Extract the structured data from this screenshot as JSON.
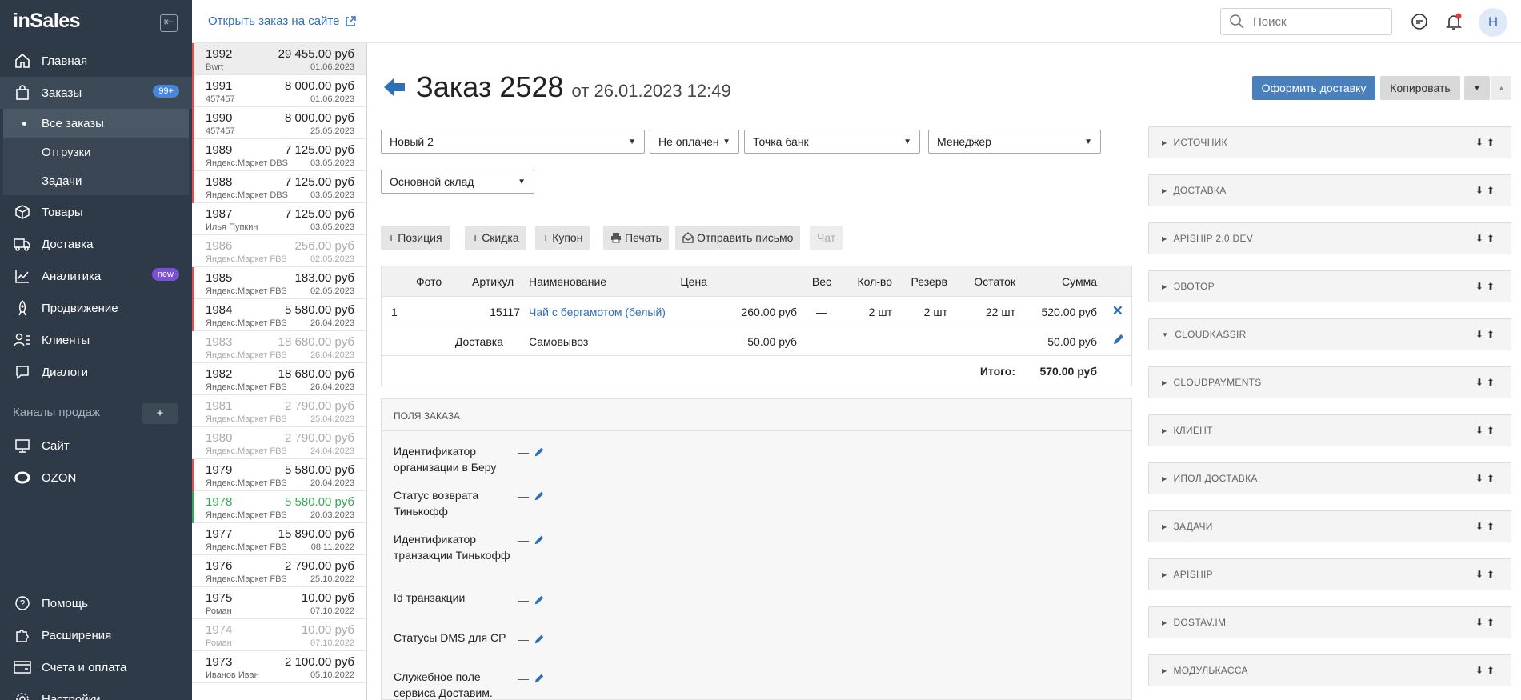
{
  "brand": {
    "logo": "inSales",
    "accent": "#4a7fbe"
  },
  "sidebar": {
    "nav": [
      {
        "label": "Главная",
        "icon": "home-icon"
      },
      {
        "label": "Заказы",
        "icon": "shopping-bag-icon",
        "badge": "99+"
      },
      {
        "label": "Товары",
        "icon": "box-icon"
      },
      {
        "label": "Доставка",
        "icon": "truck-icon"
      },
      {
        "label": "Аналитика",
        "icon": "chart-line-icon",
        "badge": "new"
      },
      {
        "label": "Продвижение",
        "icon": "rocket-icon"
      },
      {
        "label": "Клиенты",
        "icon": "users-icon"
      },
      {
        "label": "Диалоги",
        "icon": "chat-icon"
      }
    ],
    "orders_sub": [
      "Все заказы",
      "Отгрузки",
      "Задачи"
    ],
    "channels_label": "Каналы продаж",
    "channels_plus": "+",
    "channels": [
      {
        "label": "Сайт",
        "icon": "monitor-icon"
      },
      {
        "label": "OZON",
        "icon": "ozon-icon"
      }
    ],
    "bottom": [
      {
        "label": "Помощь",
        "icon": "help-icon"
      },
      {
        "label": "Расширения",
        "icon": "puzzle-icon"
      },
      {
        "label": "Счета и оплата",
        "icon": "wallet-icon"
      },
      {
        "label": "Настройки",
        "icon": "gear-icon"
      }
    ]
  },
  "topbar": {
    "open_link": "Открыть заказ на сайте",
    "search_placeholder": "Поиск",
    "avatar": "Н"
  },
  "orders": [
    {
      "num": "1992",
      "amount": "29 455.00 руб",
      "customer": "Bwrt",
      "date": "01.06.2023",
      "mark": "red",
      "selected": true
    },
    {
      "num": "1991",
      "amount": "8 000.00 руб",
      "customer": "457457",
      "date": "01.06.2023",
      "mark": "red"
    },
    {
      "num": "1990",
      "amount": "8 000.00 руб",
      "customer": "457457",
      "date": "25.05.2023",
      "mark": "red"
    },
    {
      "num": "1989",
      "amount": "7 125.00 руб",
      "customer": "Яндекс.Маркет DBS",
      "date": "03.05.2023",
      "mark": "red"
    },
    {
      "num": "1988",
      "amount": "7 125.00 руб",
      "customer": "Яндекс.Маркет DBS",
      "date": "03.05.2023",
      "mark": "red"
    },
    {
      "num": "1987",
      "amount": "7 125.00 руб",
      "customer": "Илья Пупкин",
      "date": "03.05.2023",
      "mark": ""
    },
    {
      "num": "1986",
      "amount": "256.00 руб",
      "customer": "Яндекс.Маркет FBS",
      "date": "02.05.2023",
      "mark": "",
      "muted": true
    },
    {
      "num": "1985",
      "amount": "183.00 руб",
      "customer": "Яндекс.Маркет FBS",
      "date": "02.05.2023",
      "mark": "red"
    },
    {
      "num": "1984",
      "amount": "5 580.00 руб",
      "customer": "Яндекс.Маркет FBS",
      "date": "26.04.2023",
      "mark": "red"
    },
    {
      "num": "1983",
      "amount": "18 680.00 руб",
      "customer": "Яндекс.Маркет FBS",
      "date": "26.04.2023",
      "mark": "",
      "muted": true
    },
    {
      "num": "1982",
      "amount": "18 680.00 руб",
      "customer": "Яндекс.Маркет FBS",
      "date": "26.04.2023",
      "mark": ""
    },
    {
      "num": "1981",
      "amount": "2 790.00 руб",
      "customer": "Яндекс.Маркет FBS",
      "date": "25.04.2023",
      "mark": "",
      "muted": true
    },
    {
      "num": "1980",
      "amount": "2 790.00 руб",
      "customer": "Яндекс.Маркет FBS",
      "date": "24.04.2023",
      "mark": "",
      "muted": true
    },
    {
      "num": "1979",
      "amount": "5 580.00 руб",
      "customer": "Яндекс.Маркет FBS",
      "date": "20.04.2023",
      "mark": "red"
    },
    {
      "num": "1978",
      "amount": "5 580.00 руб",
      "customer": "Яндекс.Маркет FBS",
      "date": "20.03.2023",
      "mark": "green",
      "green": true
    },
    {
      "num": "1977",
      "amount": "15 890.00 руб",
      "customer": "Яндекс.Маркет FBS",
      "date": "08.11.2022",
      "mark": ""
    },
    {
      "num": "1976",
      "amount": "2 790.00 руб",
      "customer": "Яндекс.Маркет FBS",
      "date": "25.10.2022",
      "mark": ""
    },
    {
      "num": "1975",
      "amount": "10.00 руб",
      "customer": "Роман",
      "date": "07.10.2022",
      "mark": ""
    },
    {
      "num": "1974",
      "amount": "10.00 руб",
      "customer": "Роман",
      "date": "07.10.2022",
      "mark": "",
      "muted": true
    },
    {
      "num": "1973",
      "amount": "2 100.00 руб",
      "customer": "Иванов Иван",
      "date": "05.10.2022",
      "mark": ""
    }
  ],
  "order": {
    "title": "Заказ 2528",
    "subtitle": "от 26.01.2023 12:49",
    "btn_delivery": "Оформить доставку",
    "btn_copy": "Копировать",
    "status": "Новый 2",
    "payment_status": "Не оплачен",
    "payment_method": "Точка банк",
    "manager": "Менеджер",
    "warehouse": "Основной склад",
    "tools": [
      "Позиция",
      "Скидка",
      "Купон",
      "Печать",
      "Отправить письмо",
      "Чат"
    ],
    "table": {
      "headers": [
        "Фото",
        "Артикул",
        "Наименование",
        "Цена",
        "Вес",
        "Кол-во",
        "Резерв",
        "Остаток",
        "Сумма"
      ],
      "row": {
        "idx": "1",
        "sku": "15117",
        "name": "Чай с бергамотом (белый)",
        "price": "260.00 руб",
        "weight": "—",
        "qty": "2 шт",
        "reserve": "2 шт",
        "stock": "22 шт",
        "sum": "520.00 руб"
      },
      "delivery": {
        "label": "Доставка",
        "name": "Самовывоз",
        "price": "50.00 руб",
        "sum": "50.00 руб"
      },
      "total_label": "Итого:",
      "total": "570.00 руб"
    },
    "fields_title": "ПОЛЯ ЗАКАЗА",
    "fields": [
      {
        "label": "Идентификатор организации в Беру",
        "value": "—"
      },
      {
        "label": "Статус возврата Тинькофф",
        "value": "—"
      },
      {
        "label": "Идентификатор транзакции Тинькофф",
        "value": "—"
      },
      {
        "label": "Id транзакции",
        "value": "—"
      },
      {
        "label": "Статусы DMS для CP",
        "value": "—"
      },
      {
        "label": "Служебное поле сервиса Доставим.",
        "value": "—"
      }
    ]
  },
  "panels": [
    {
      "label": "ИСТОЧНИК",
      "open": false
    },
    {
      "label": "ДОСТАВКА",
      "open": false
    },
    {
      "label": "APISHIP 2.0 DEV",
      "open": false
    },
    {
      "label": "ЭВОТОР",
      "open": false
    },
    {
      "label": "CLOUDKASSIR",
      "open": true
    },
    {
      "label": "CLOUDPAYMENTS",
      "open": false
    },
    {
      "label": "КЛИЕНТ",
      "open": false
    },
    {
      "label": "ИПОЛ ДОСТАВКА",
      "open": false
    },
    {
      "label": "ЗАДАЧИ",
      "open": false
    },
    {
      "label": "APISHIP",
      "open": false
    },
    {
      "label": "DOSTAV.IM",
      "open": false
    },
    {
      "label": "МОДУЛЬКАССА",
      "open": false
    }
  ]
}
